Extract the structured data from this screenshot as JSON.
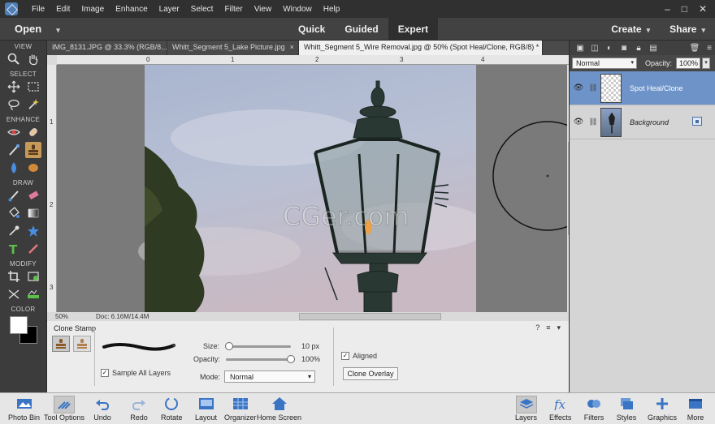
{
  "menubar": {
    "items": [
      "File",
      "Edit",
      "Image",
      "Enhance",
      "Layer",
      "Select",
      "Filter",
      "View",
      "Window",
      "Help"
    ]
  },
  "modebar": {
    "open_label": "Open",
    "modes": [
      "Quick",
      "Guided",
      "Expert"
    ],
    "active_mode": "Expert",
    "create_label": "Create",
    "share_label": "Share"
  },
  "toolbar": {
    "sections": [
      "VIEW",
      "SELECT",
      "ENHANCE",
      "DRAW",
      "MODIFY",
      "COLOR"
    ]
  },
  "tabs": [
    {
      "label": "IMG_8131.JPG @ 33.3% (RGB/8...",
      "close": "×"
    },
    {
      "label": "Whitt_Segment 5_Lake Picture.jpg",
      "close": "×"
    },
    {
      "label": "Whitt_Segment 5_Wire Removal.jpg @ 50% (Spot Heal/Clone, RGB/8) *",
      "close": "×"
    }
  ],
  "rulers": {
    "top": [
      "0",
      "1",
      "2",
      "3",
      "4"
    ],
    "left": [
      "1",
      "2",
      "3"
    ]
  },
  "canvas": {
    "watermark": "CGer.com"
  },
  "status": {
    "zoom": "50%",
    "doc": "Doc: 6.16M/14.4M"
  },
  "tool_options": {
    "title": "Clone Stamp",
    "sample_all_layers": "Sample All Layers",
    "size_label": "Size:",
    "size_value": "10 px",
    "opacity_label": "Opacity:",
    "opacity_value": "100%",
    "mode_label": "Mode:",
    "mode_value": "Normal",
    "aligned_label": "Aligned",
    "clone_overlay_label": "Clone Overlay",
    "size_level": 0.05,
    "opacity_level": 1.0
  },
  "layers_panel": {
    "blend_mode": "Normal",
    "opacity_label": "Opacity:",
    "opacity_value": "100%",
    "layers": [
      {
        "name": "Spot Heal/Clone",
        "active": true
      },
      {
        "name": "Background",
        "active": false
      }
    ]
  },
  "taskbar": {
    "items": [
      "Photo Bin",
      "Tool Options",
      "Undo",
      "Redo",
      "Rotate",
      "Layout",
      "Organizer",
      "Home Screen",
      "Layers",
      "Effects",
      "Filters",
      "Styles",
      "Graphics",
      "More"
    ]
  },
  "colors": {
    "accent": "#6e93c9",
    "active_tool": "#c59a59",
    "chrome_dark": "#303030"
  }
}
